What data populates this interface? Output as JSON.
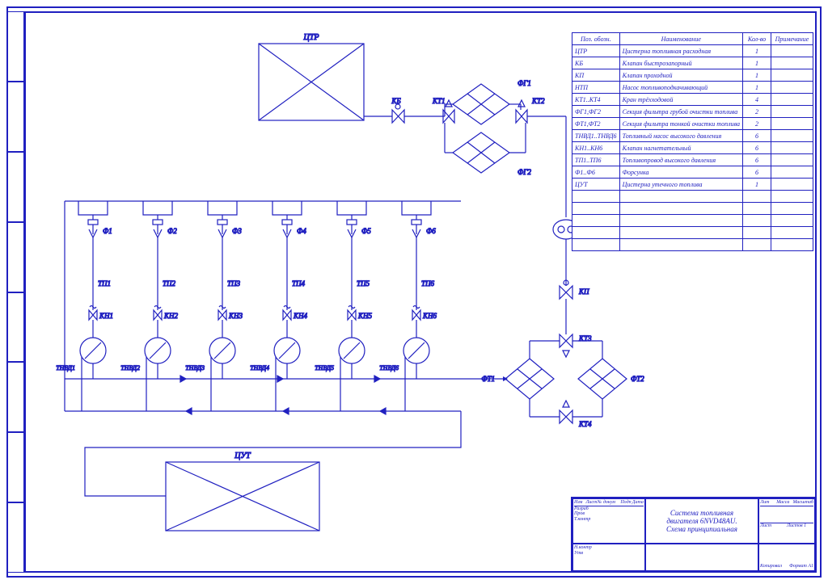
{
  "colors": {
    "line": "#2020c0",
    "paper": "#ffffff"
  },
  "side_strip_cells": [
    "",
    "",
    "",
    "",
    "",
    "",
    "",
    ""
  ],
  "schematic": {
    "tanks": {
      "top": "ЦТР",
      "bottom": "ЦУТ"
    },
    "valves": {
      "kb": "КБ",
      "kp": "КП"
    },
    "pump": "НТП",
    "kt": [
      "КТ1",
      "КТ2",
      "КТ3",
      "КТ4"
    ],
    "fg": [
      "ФГ1",
      "ФГ2"
    ],
    "ft": [
      "ФТ1",
      "ФТ2"
    ],
    "injectors": [
      "Ф1",
      "Ф2",
      "Ф3",
      "Ф4",
      "Ф5",
      "Ф6"
    ],
    "tp": [
      "ТП1",
      "ТП2",
      "ТП3",
      "ТП4",
      "ТП5",
      "ТП6"
    ],
    "kn": [
      "КН1",
      "КН2",
      "КН3",
      "КН4",
      "КН5",
      "КН6"
    ],
    "thvd": [
      "ТНВД1",
      "ТНВД2",
      "ТНВД3",
      "ТНВД4",
      "ТНВД5",
      "ТНВД6"
    ]
  },
  "bom": {
    "headers": {
      "pos": "Поз. обозн.",
      "name": "Наименование",
      "qty": "Кол-во",
      "note": "Примечание"
    },
    "rows": [
      {
        "pos": "ЦТР",
        "name": "Цистерна топливная расходная",
        "qty": "1",
        "note": ""
      },
      {
        "pos": "КБ",
        "name": "Клапан быстрозапорный",
        "qty": "1",
        "note": ""
      },
      {
        "pos": "КП",
        "name": "Клапан проходной",
        "qty": "1",
        "note": ""
      },
      {
        "pos": "НТП",
        "name": "Насос топливоподкачивающий",
        "qty": "1",
        "note": ""
      },
      {
        "pos": "КТ1..КТ4",
        "name": "Кран трёхходовой",
        "qty": "4",
        "note": ""
      },
      {
        "pos": "ФГ1,ФГ2",
        "name": "Секция фильтра грубой очистки топлива",
        "qty": "2",
        "note": ""
      },
      {
        "pos": "ФТ1,ФТ2",
        "name": "Секция фильтра тонкой очистки топлива",
        "qty": "2",
        "note": ""
      },
      {
        "pos": "ТНВД1..ТНВД6",
        "name": "Топливный насос высокого давления",
        "qty": "6",
        "note": ""
      },
      {
        "pos": "КН1..КН6",
        "name": "Клапан нагнетательный",
        "qty": "6",
        "note": ""
      },
      {
        "pos": "ТП1..ТП6",
        "name": "Топливопровод высокого давления",
        "qty": "6",
        "note": ""
      },
      {
        "pos": "Ф1..Ф6",
        "name": "Форсунка",
        "qty": "6",
        "note": ""
      },
      {
        "pos": "ЦУТ",
        "name": "Цистерна утечного топлива",
        "qty": "1",
        "note": ""
      }
    ],
    "empty_rows": 5
  },
  "title_block": {
    "roles": [
      "Изм",
      "Лист",
      "№ докум",
      "Подп",
      "Дата"
    ],
    "lines": [
      "Разраб",
      "Пров",
      "Т.контр",
      "Н.контр",
      "Утв"
    ],
    "title1": "Система топливная",
    "title2": "двигателя 6NVD48AU.",
    "title3": "Схема принципиальная",
    "cols": [
      "Лит",
      "Масса",
      "Масштаб"
    ],
    "sheet": "Лист",
    "sheets": "Листов",
    "sheets_n": "1",
    "format": "Формат   A1",
    "bottom": "Копировал"
  }
}
